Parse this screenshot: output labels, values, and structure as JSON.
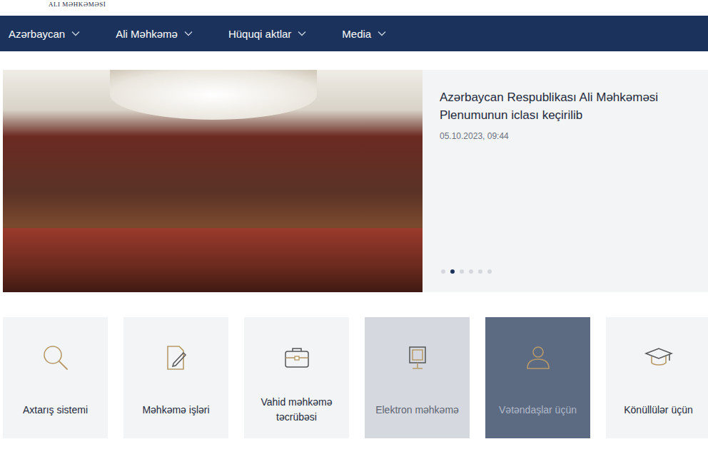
{
  "logo": {
    "text": "ALI MƏHKƏMƏSİ"
  },
  "nav": [
    {
      "label": "Azərbaycan"
    },
    {
      "label": "Ali Məhkəmə"
    },
    {
      "label": "Hüquqi aktlar"
    },
    {
      "label": "Media"
    }
  ],
  "carousel": {
    "title": "Azərbaycan Respublikası Ali Məhkəməsi Plenumunun iclası keçirilib",
    "date": "05.10.2023, 09:44",
    "slides": [
      {
        "selected": false
      },
      {
        "selected": true
      },
      {
        "selected": false
      },
      {
        "selected": false
      },
      {
        "selected": false
      },
      {
        "selected": false
      }
    ]
  },
  "cards": [
    {
      "label": "Axtarış sistemi",
      "kind": "search",
      "dimmed": false,
      "hovered": false
    },
    {
      "label": "Məhkəmə işləri",
      "kind": "document",
      "dimmed": false,
      "hovered": false
    },
    {
      "label": "Vahid məhkəmə təcrübəsi",
      "kind": "briefcase",
      "dimmed": false,
      "hovered": false
    },
    {
      "label": "Elektron məhkəmə",
      "kind": "monitor",
      "dimmed": true,
      "hovered": false
    },
    {
      "label": "Vətəndaşlar üçün",
      "kind": "person",
      "dimmed": false,
      "hovered": true
    },
    {
      "label": "Könüllülər üçün",
      "kind": "graduation",
      "dimmed": false,
      "hovered": false
    }
  ]
}
